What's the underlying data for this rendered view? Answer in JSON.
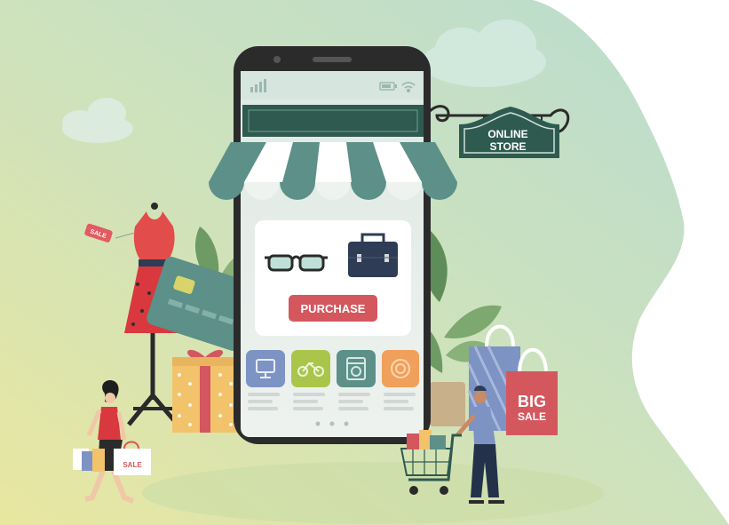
{
  "sign": {
    "line1": "ONLINE",
    "line2": "STORE"
  },
  "purchase_label": "PURCHASE",
  "big_sale": {
    "line1": "BIG",
    "line2": "SALE"
  },
  "tags": {
    "dress_tag": "SALE",
    "woman_bag": "SALE"
  },
  "colors": {
    "teal": "#5c9088",
    "dark_teal": "#2f5a50",
    "red": "#d4575e",
    "navy": "#2f3c55",
    "green_tile": "#a9c64b",
    "orange_tile": "#f0a05a",
    "blue_tile": "#7d93c4"
  },
  "category_icons": [
    "monitor-icon",
    "bicycle-icon",
    "washing-machine-icon",
    "camera-lens-icon"
  ],
  "product_icons": [
    "glasses-icon",
    "briefcase-icon"
  ],
  "status_icons": [
    "signal-icon",
    "battery-icon",
    "wifi-icon"
  ]
}
